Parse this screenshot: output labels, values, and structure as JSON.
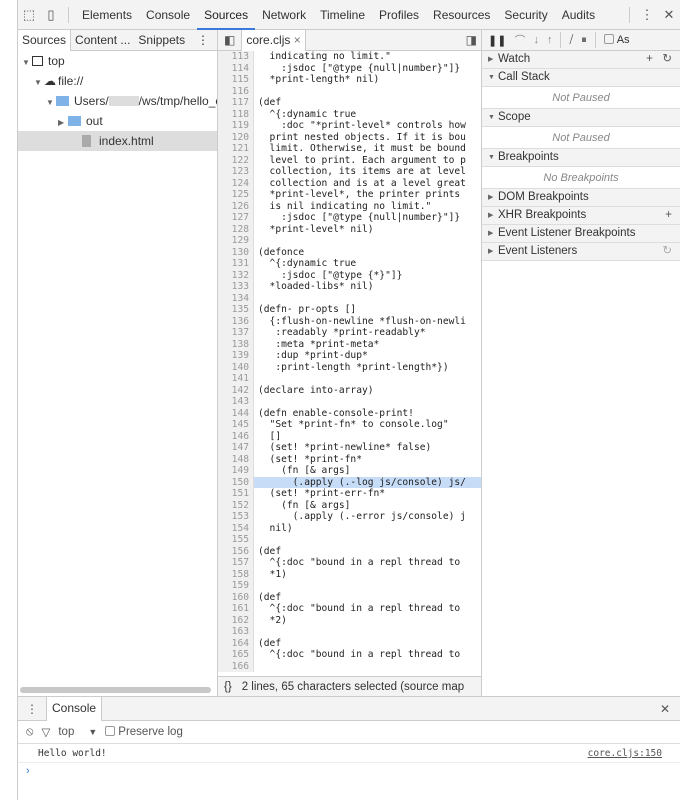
{
  "toolbar": {
    "tabs": [
      "Elements",
      "Console",
      "Sources",
      "Network",
      "Timeline",
      "Profiles",
      "Resources",
      "Security",
      "Audits"
    ],
    "active": "Sources"
  },
  "navigator": {
    "tabs": [
      "Sources",
      "Content ...",
      "Snippets"
    ],
    "tree": {
      "top": "top",
      "origin": "file://",
      "users_prefix": "Users/",
      "users_suffix": "/ws/tmp/hello_c",
      "out": "out",
      "index": "index.html"
    }
  },
  "editor": {
    "file_tab": "core.cljs",
    "highlight_line": 150,
    "lines": [
      [
        113,
        "  indicating no limit.\""
      ],
      [
        114,
        "    :jsdoc [\"@type {null|number}\"]}"
      ],
      [
        115,
        "  *print-length* nil)"
      ],
      [
        116,
        ""
      ],
      [
        117,
        "(def"
      ],
      [
        118,
        "  ^{:dynamic true"
      ],
      [
        119,
        "    :doc \"*print-level* controls how"
      ],
      [
        120,
        "  print nested objects. If it is bou"
      ],
      [
        121,
        "  limit. Otherwise, it must be bound"
      ],
      [
        122,
        "  level to print. Each argument to p"
      ],
      [
        123,
        "  collection, its items are at level"
      ],
      [
        124,
        "  collection and is at a level great"
      ],
      [
        125,
        "  *print-level*, the printer prints "
      ],
      [
        126,
        "  is nil indicating no limit.\""
      ],
      [
        127,
        "    :jsdoc [\"@type {null|number}\"]}"
      ],
      [
        128,
        "  *print-level* nil)"
      ],
      [
        129,
        ""
      ],
      [
        130,
        "(defonce"
      ],
      [
        131,
        "  ^{:dynamic true"
      ],
      [
        132,
        "    :jsdoc [\"@type {*}\"]}"
      ],
      [
        133,
        "  *loaded-libs* nil)"
      ],
      [
        134,
        ""
      ],
      [
        135,
        "(defn- pr-opts []"
      ],
      [
        136,
        "  {:flush-on-newline *flush-on-newli"
      ],
      [
        137,
        "   :readably *print-readably*"
      ],
      [
        138,
        "   :meta *print-meta*"
      ],
      [
        139,
        "   :dup *print-dup*"
      ],
      [
        140,
        "   :print-length *print-length*})"
      ],
      [
        141,
        ""
      ],
      [
        142,
        "(declare into-array)"
      ],
      [
        143,
        ""
      ],
      [
        144,
        "(defn enable-console-print!"
      ],
      [
        145,
        "  \"Set *print-fn* to console.log\""
      ],
      [
        146,
        "  []"
      ],
      [
        147,
        "  (set! *print-newline* false)"
      ],
      [
        148,
        "  (set! *print-fn*"
      ],
      [
        149,
        "    (fn [& args]"
      ],
      [
        150,
        "      (.apply (.-log js/console) js/"
      ],
      [
        151,
        "  (set! *print-err-fn*"
      ],
      [
        152,
        "    (fn [& args]"
      ],
      [
        153,
        "      (.apply (.-error js/console) j"
      ],
      [
        154,
        "  nil)"
      ],
      [
        155,
        ""
      ],
      [
        156,
        "(def"
      ],
      [
        157,
        "  ^{:doc \"bound in a repl thread to"
      ],
      [
        158,
        "  *1)"
      ],
      [
        159,
        ""
      ],
      [
        160,
        "(def"
      ],
      [
        161,
        "  ^{:doc \"bound in a repl thread to"
      ],
      [
        162,
        "  *2)"
      ],
      [
        163,
        ""
      ],
      [
        164,
        "(def"
      ],
      [
        165,
        "  ^{:doc \"bound in a repl thread to"
      ],
      [
        166,
        ""
      ]
    ],
    "status": "2 lines, 65 characters selected  (source map"
  },
  "debugger": {
    "async_label": "As",
    "sections": [
      {
        "label": "Watch",
        "open": false,
        "empty": ""
      },
      {
        "label": "Call Stack",
        "open": true,
        "empty": "Not Paused"
      },
      {
        "label": "Scope",
        "open": true,
        "empty": "Not Paused"
      },
      {
        "label": "Breakpoints",
        "open": true,
        "empty": "No Breakpoints"
      },
      {
        "label": "DOM Breakpoints",
        "open": false,
        "empty": ""
      },
      {
        "label": "XHR Breakpoints",
        "open": false,
        "empty": ""
      },
      {
        "label": "Event Listener Breakpoints",
        "open": false,
        "empty": ""
      },
      {
        "label": "Event Listeners",
        "open": false,
        "empty": ""
      }
    ]
  },
  "console": {
    "tab": "Console",
    "context": "top",
    "preserve_log": "Preserve log",
    "messages": [
      {
        "text": "Hello world!",
        "source": "core.cljs:150"
      }
    ]
  }
}
